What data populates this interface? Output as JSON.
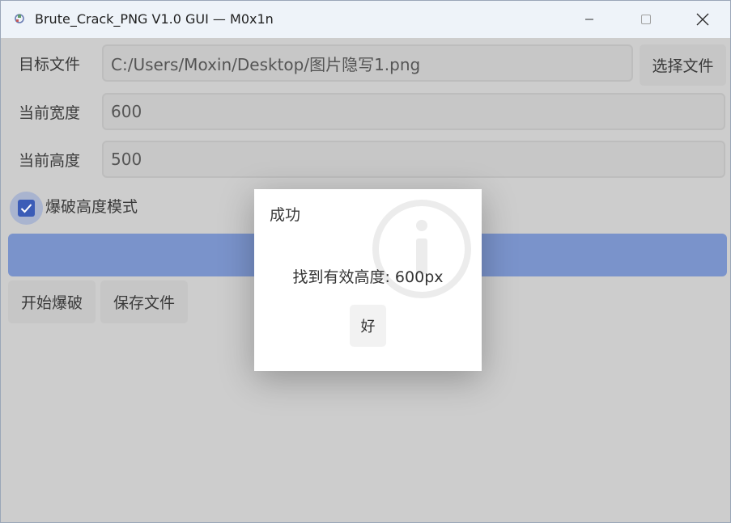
{
  "window": {
    "title": "Brute_Crack_PNG V1.0 GUI — M0x1n",
    "icon": "app-icon"
  },
  "titlebar_controls": {
    "minimize_icon": "minimize-icon",
    "maximize_icon": "maximize-icon",
    "close_icon": "close-icon"
  },
  "form": {
    "target_file": {
      "label": "目标文件",
      "value": "C:/Users/Moxin/Desktop/图片隐写1.png",
      "browse_label": "选择文件"
    },
    "current_width": {
      "label": "当前宽度",
      "value": "600"
    },
    "current_height": {
      "label": "当前高度",
      "value": "500"
    },
    "mode": {
      "label": "爆破高度模式",
      "checked": true
    }
  },
  "progress": {
    "value": 100
  },
  "actions": {
    "start_label": "开始爆破",
    "save_label": "保存文件"
  },
  "dialog": {
    "title": "成功",
    "message": "找到有效高度: 600px",
    "ok_label": "好",
    "icon": "info-icon"
  },
  "colors": {
    "accent": "#3b5cb7",
    "progress_fill": "#7a93cb",
    "background": "#cdcdcd",
    "titlebar": "#eef3f9"
  }
}
